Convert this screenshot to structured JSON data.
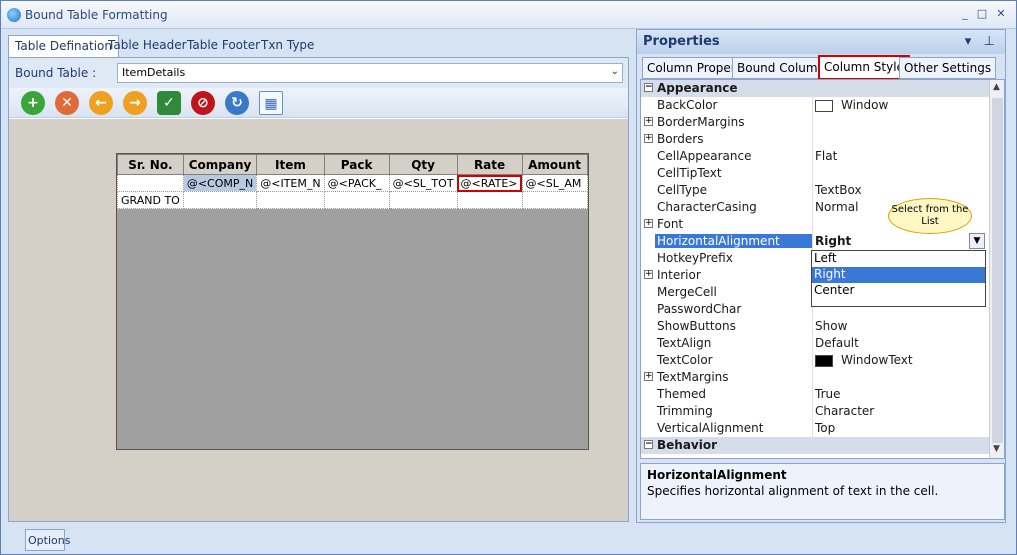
{
  "window": {
    "title": "Bound Table Formatting",
    "buttons": [
      "_",
      "□",
      "✕"
    ]
  },
  "left_tabs": [
    "Table Defination",
    "Table Header",
    "Table Footer",
    "Txn Type"
  ],
  "bound_table": {
    "label": "Bound Table :",
    "value": "ItemDetails"
  },
  "toolbar": {
    "icons": [
      "add-icon",
      "delete-icon",
      "back-icon",
      "forward-icon",
      "shield-icon",
      "stop-icon",
      "refresh-icon",
      "layout-icon"
    ]
  },
  "grid": {
    "headers": [
      "Sr. No.",
      "Company",
      "Item",
      "Pack",
      "Qty",
      "Rate",
      "Amount"
    ],
    "rows": [
      [
        "",
        "@<COMP_N",
        "@<ITEM_N",
        "@<PACK_",
        "@<SL_TOT",
        "@<RATE>",
        "@<SL_AM"
      ],
      [
        "GRAND TO",
        "",
        "",
        "",
        "",
        "",
        ""
      ]
    ]
  },
  "status_tab": "Options",
  "properties": {
    "title": "Properties",
    "tabs": [
      "Column Property",
      "Bound Columns",
      "Column Style",
      "Other Settings"
    ],
    "active_tab": "Column Style",
    "rows": [
      {
        "type": "cat",
        "name": "Appearance"
      },
      {
        "name": "BackColor",
        "value": "Window",
        "swatch": "#ffffff"
      },
      {
        "name": "BorderMargins",
        "value": "",
        "plus": true
      },
      {
        "name": "Borders",
        "value": "",
        "plus": true
      },
      {
        "name": "CellAppearance",
        "value": "Flat"
      },
      {
        "name": "CellTipText",
        "value": ""
      },
      {
        "name": "CellType",
        "value": "TextBox"
      },
      {
        "name": "CharacterCasing",
        "value": "Normal"
      },
      {
        "name": "Font",
        "value": "",
        "plus": true
      },
      {
        "name": "HorizontalAlignment",
        "value": "Right",
        "selected": true
      },
      {
        "name": "HotkeyPrefix",
        "value": ""
      },
      {
        "name": "Interior",
        "value": "",
        "plus": true
      },
      {
        "name": "MergeCell",
        "value": ""
      },
      {
        "name": "PasswordChar",
        "value": ""
      },
      {
        "name": "ShowButtons",
        "value": "Show"
      },
      {
        "name": "TextAlign",
        "value": "Default"
      },
      {
        "name": "TextColor",
        "value": "WindowText",
        "swatch": "#000000"
      },
      {
        "name": "TextMargins",
        "value": "",
        "plus": true
      },
      {
        "name": "Themed",
        "value": "True"
      },
      {
        "name": "Trimming",
        "value": "Character"
      },
      {
        "name": "VerticalAlignment",
        "value": "Top"
      },
      {
        "type": "cat",
        "name": "Behavior"
      }
    ],
    "dropdown_options": [
      "Left",
      "Right",
      "Center"
    ],
    "dropdown_selected": "Right",
    "callout": "Select from the List",
    "description": {
      "title": "HorizontalAlignment",
      "text": "Specifies horizontal alignment of text in the cell."
    }
  }
}
